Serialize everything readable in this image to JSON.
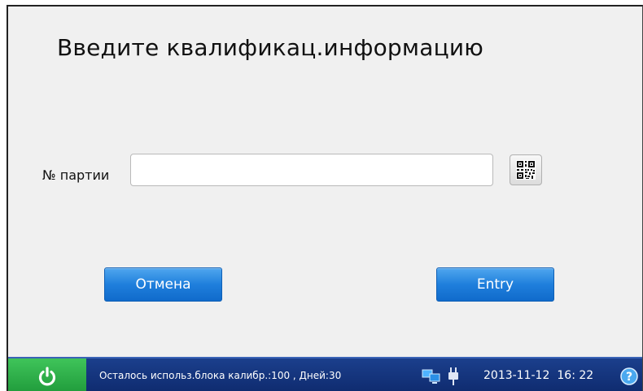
{
  "page": {
    "title": "Введите квалификац.информацию"
  },
  "form": {
    "lot_label": "№ партии",
    "lot_value": "",
    "qr_icon": "qr-code-icon"
  },
  "buttons": {
    "cancel_label": "Отмена",
    "entry_label": "Entry"
  },
  "statusbar": {
    "power_icon": "power-icon",
    "message": "Осталось использ.блока калибр.:100 , Дней:30",
    "network_icon": "network-icon",
    "plug_icon": "power-plug-icon",
    "date": "2013-11-12",
    "time": "16: 22",
    "help_icon": "help-icon"
  },
  "colors": {
    "button_blue": "#1f7fdc",
    "statusbar_blue": "#1b3f8c",
    "power_green": "#2bb047",
    "background": "#f0f0f0"
  }
}
